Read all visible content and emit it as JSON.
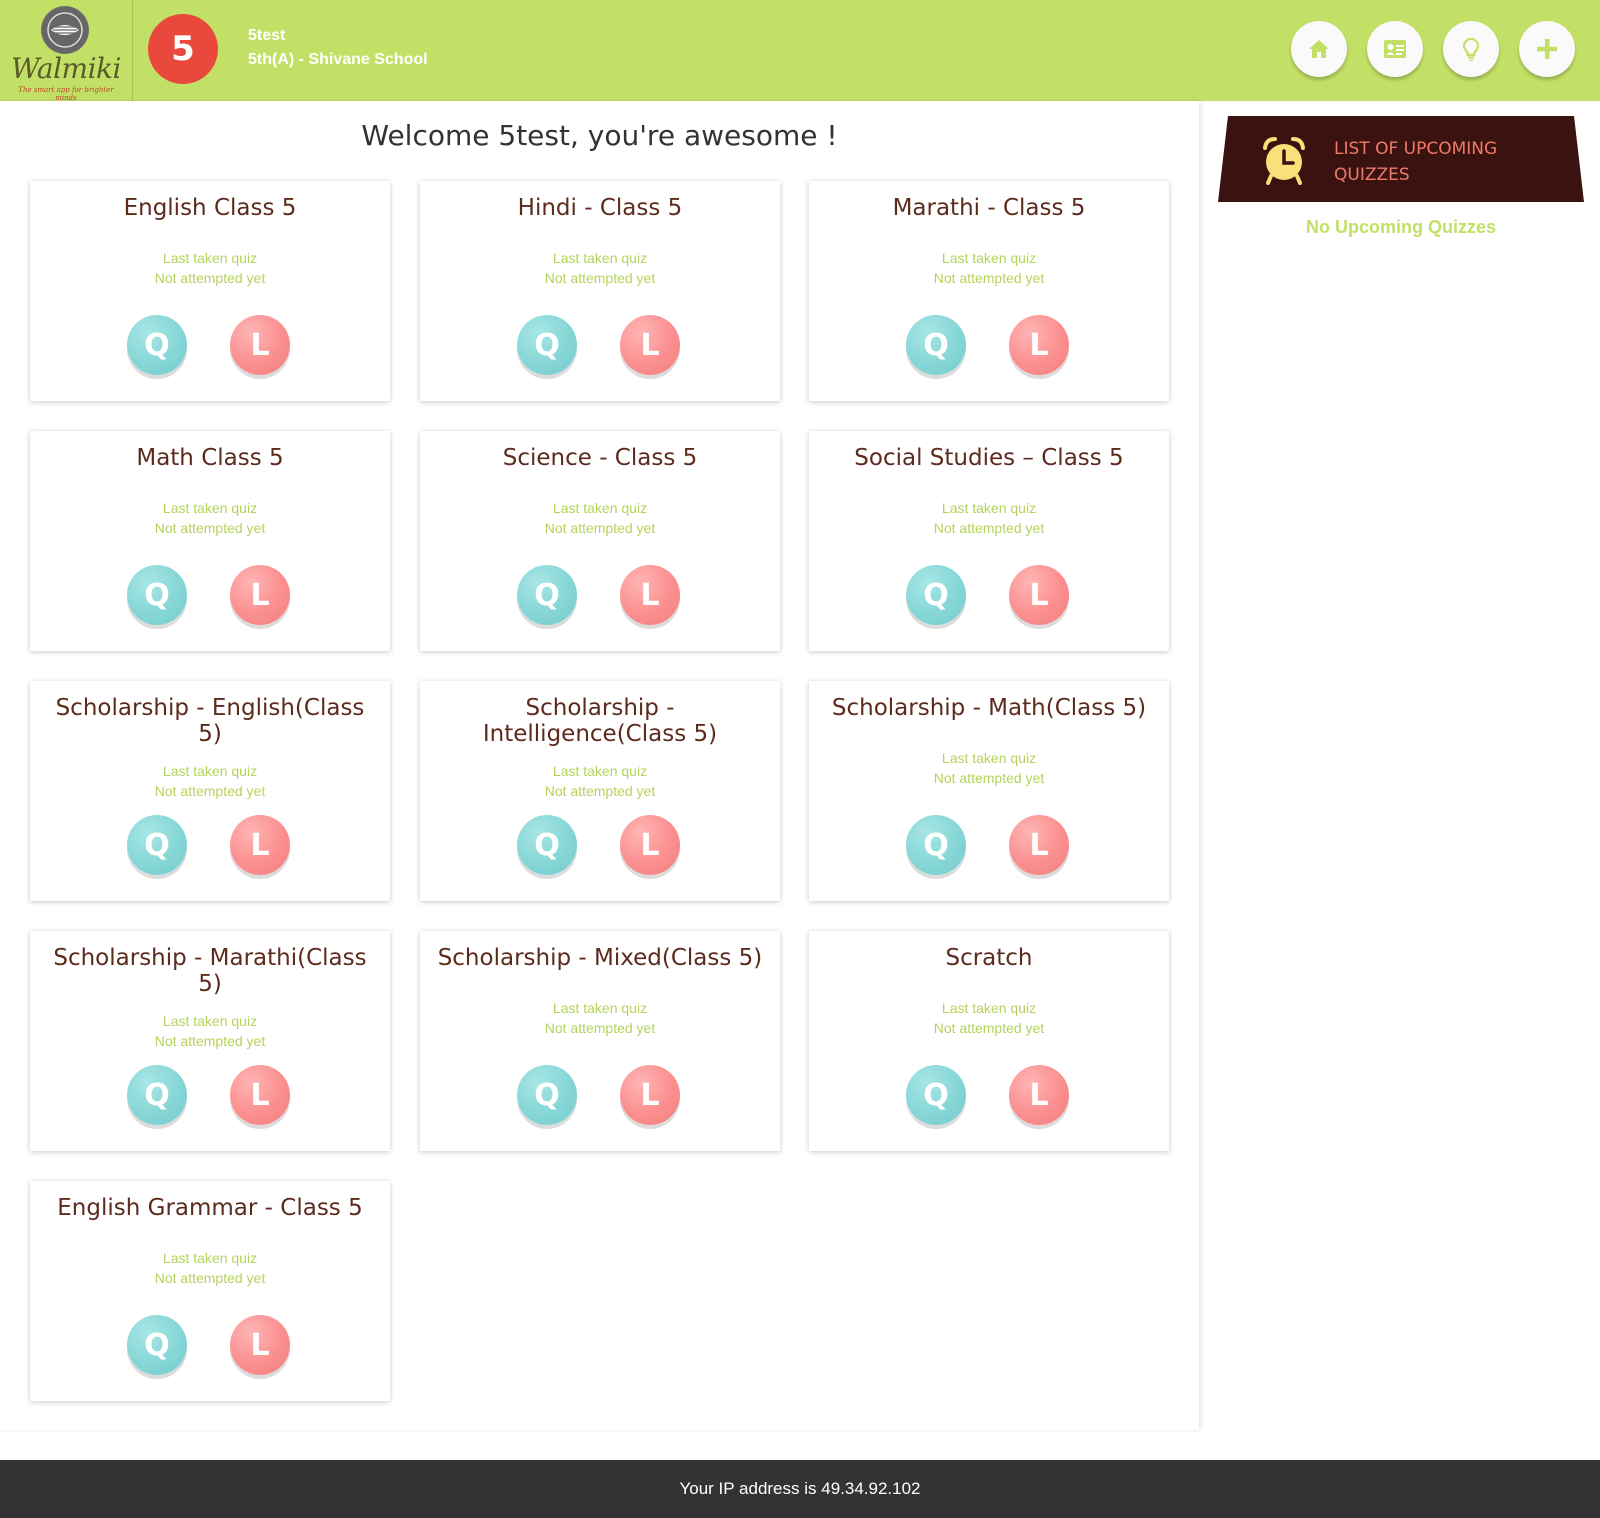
{
  "header": {
    "logo_text": "Walmiki",
    "logo_tagline": "The smart app for brighter minds",
    "grade_badge": "5",
    "user_name": "5test",
    "user_class": "5th(A) - Shivane School",
    "nav": [
      {
        "name": "home-icon"
      },
      {
        "name": "profile-card-icon"
      },
      {
        "name": "lightbulb-icon"
      },
      {
        "name": "plus-icon"
      }
    ]
  },
  "main": {
    "welcome": "Welcome 5test, you're awesome !",
    "cards": [
      {
        "title": "English Class 5",
        "last_taken": "Last taken quiz",
        "status": "Not attempted yet",
        "q": "Q",
        "l": "L"
      },
      {
        "title": "Hindi - Class 5",
        "last_taken": "Last taken quiz",
        "status": "Not attempted yet",
        "q": "Q",
        "l": "L"
      },
      {
        "title": "Marathi - Class 5",
        "last_taken": "Last taken quiz",
        "status": "Not attempted yet",
        "q": "Q",
        "l": "L"
      },
      {
        "title": "Math Class 5",
        "last_taken": "Last taken quiz",
        "status": "Not attempted yet",
        "q": "Q",
        "l": "L"
      },
      {
        "title": "Science - Class 5",
        "last_taken": "Last taken quiz",
        "status": "Not attempted yet",
        "q": "Q",
        "l": "L"
      },
      {
        "title": "Social Studies – Class 5",
        "last_taken": "Last taken quiz",
        "status": "Not attempted yet",
        "q": "Q",
        "l": "L"
      },
      {
        "title": "Scholarship - English(Class 5)",
        "last_taken": "Last taken quiz",
        "status": "Not attempted yet",
        "q": "Q",
        "l": "L"
      },
      {
        "title": "Scholarship - Intelligence(Class 5)",
        "last_taken": "Last taken quiz",
        "status": "Not attempted yet",
        "q": "Q",
        "l": "L"
      },
      {
        "title": "Scholarship - Math(Class 5)",
        "last_taken": "Last taken quiz",
        "status": "Not attempted yet",
        "q": "Q",
        "l": "L"
      },
      {
        "title": "Scholarship - Marathi(Class 5)",
        "last_taken": "Last taken quiz",
        "status": "Not attempted yet",
        "q": "Q",
        "l": "L"
      },
      {
        "title": "Scholarship - Mixed(Class 5)",
        "last_taken": "Last taken quiz",
        "status": "Not attempted yet",
        "q": "Q",
        "l": "L"
      },
      {
        "title": "Scratch",
        "last_taken": "Last taken quiz",
        "status": "Not attempted yet",
        "q": "Q",
        "l": "L"
      },
      {
        "title": "English Grammar - Class 5",
        "last_taken": "Last taken quiz",
        "status": "Not attempted yet",
        "q": "Q",
        "l": "L"
      }
    ]
  },
  "sidebar": {
    "upcoming_title": "LIST OF UPCOMING QUIZZES",
    "no_quizzes": "No Upcoming Quizzes"
  },
  "footer": {
    "ip_text": "Your IP address is 49.34.92.102"
  },
  "colors": {
    "header_bg": "#c3e066",
    "grade_badge": "#e8493c",
    "card_title": "#5c2b1e",
    "card_sub": "#b5d35a",
    "quiz_button": "#86d6d6",
    "learn_button": "#fb8f8f",
    "banner_bg": "#3a1210",
    "banner_text": "#f07a6a",
    "footer_bg": "#333333"
  }
}
